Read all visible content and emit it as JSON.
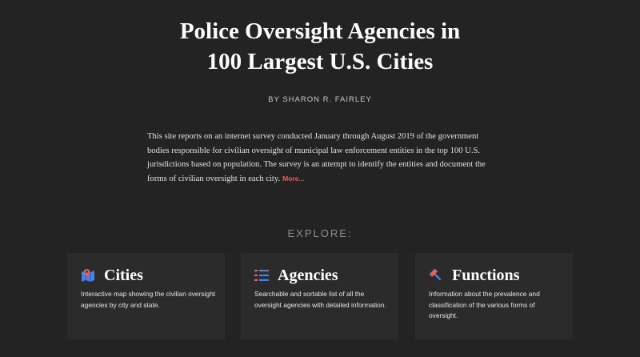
{
  "header": {
    "title_line1": "Police Oversight Agencies in",
    "title_line2": "100 Largest U.S. Cities",
    "byline": "BY SHARON R. FAIRLEY"
  },
  "intro": {
    "text": "This site reports on an internet survey conducted January through August 2019 of the government bodies responsible for civilian oversight of municipal law enforcement entities in the top 100 U.S. jurisdictions based on population. The survey is an attempt to identify the entities and document the forms of civilian oversight in each city.",
    "more_label": "More..."
  },
  "explore": {
    "heading": "EXPLORE:"
  },
  "cards": [
    {
      "title": "Cities",
      "description": "Interactive map showing the civilian oversight agencies by city and state.",
      "icon": "map-icon"
    },
    {
      "title": "Agencies",
      "description": "Searchable and sortable list of all the oversight agencies with detailed information.",
      "icon": "list-icon"
    },
    {
      "title": "Functions",
      "description": "Information about the prevalence and classification of the various forms of oversight.",
      "icon": "gavel-icon"
    }
  ],
  "colors": {
    "background": "#232323",
    "card_background": "#2b2b2b",
    "accent_link": "#e0645c",
    "icon_blue": "#4f7fe0",
    "icon_red": "#e0645c"
  }
}
